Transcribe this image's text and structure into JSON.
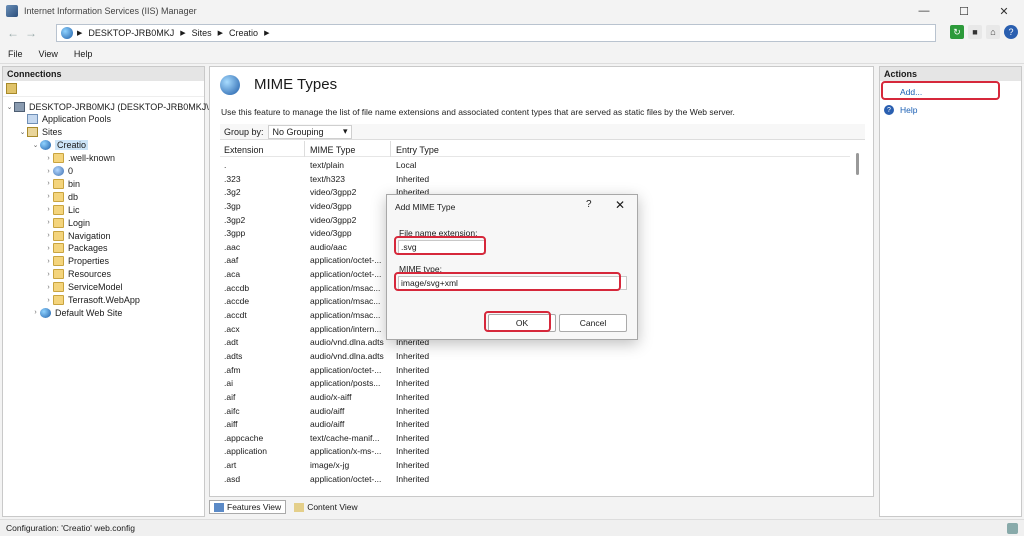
{
  "window": {
    "title": "Internet Information Services (IIS) Manager",
    "controls": [
      "—",
      "☐",
      "✕"
    ]
  },
  "address": {
    "breadcrumb": [
      "DESKTOP-JRB0MKJ",
      "Sites",
      "Creatio"
    ]
  },
  "menu": [
    "File",
    "View",
    "Help"
  ],
  "connections": {
    "header": "Connections",
    "tree": [
      {
        "label": "DESKTOP-JRB0MKJ (DESKTOP-JRB0MKJ\\Safa",
        "icon": "server-icon",
        "level": 0,
        "expander": "expanded"
      },
      {
        "label": "Application Pools",
        "icon": "app-pool-icon",
        "level": 1,
        "expander": "none"
      },
      {
        "label": "Sites",
        "icon": "sites-icon",
        "level": 1,
        "expander": "expanded"
      },
      {
        "label": "Creatio",
        "icon": "globe-icon",
        "level": 2,
        "expander": "expanded",
        "selected": true
      },
      {
        "label": ".well-known",
        "icon": "folder-icon",
        "level": 3,
        "expander": "collapsed"
      },
      {
        "label": "0",
        "icon": "app-icon",
        "level": 3,
        "expander": "collapsed"
      },
      {
        "label": "bin",
        "icon": "folder-icon",
        "level": 3,
        "expander": "collapsed"
      },
      {
        "label": "db",
        "icon": "folder-icon",
        "level": 3,
        "expander": "collapsed"
      },
      {
        "label": "Lic",
        "icon": "folder-icon",
        "level": 3,
        "expander": "collapsed"
      },
      {
        "label": "Login",
        "icon": "folder-icon",
        "level": 3,
        "expander": "collapsed"
      },
      {
        "label": "Navigation",
        "icon": "folder-icon",
        "level": 3,
        "expander": "collapsed"
      },
      {
        "label": "Packages",
        "icon": "folder-icon",
        "level": 3,
        "expander": "collapsed"
      },
      {
        "label": "Properties",
        "icon": "folder-icon",
        "level": 3,
        "expander": "collapsed"
      },
      {
        "label": "Resources",
        "icon": "folder-icon",
        "level": 3,
        "expander": "collapsed"
      },
      {
        "label": "ServiceModel",
        "icon": "folder-icon",
        "level": 3,
        "expander": "collapsed"
      },
      {
        "label": "Terrasoft.WebApp",
        "icon": "folder-icon",
        "level": 3,
        "expander": "collapsed"
      },
      {
        "label": "Default Web Site",
        "icon": "globe-icon",
        "level": 2,
        "expander": "collapsed"
      }
    ]
  },
  "content": {
    "title": "MIME Types",
    "description": "Use this feature to manage the list of file name extensions and associated content types that are served as static files by the Web server.",
    "group_by_label": "Group by:",
    "group_by_value": "No Grouping",
    "columns": [
      "Extension",
      "MIME Type",
      "Entry Type"
    ],
    "rows": [
      [
        ".",
        "text/plain",
        "Local"
      ],
      [
        ".323",
        "text/h323",
        "Inherited"
      ],
      [
        ".3g2",
        "video/3gpp2",
        "Inherited"
      ],
      [
        ".3gp",
        "video/3gpp",
        "Inherited"
      ],
      [
        ".3gp2",
        "video/3gpp2",
        "Inherited"
      ],
      [
        ".3gpp",
        "video/3gpp",
        "Inherited"
      ],
      [
        ".aac",
        "audio/aac",
        "Inherited"
      ],
      [
        ".aaf",
        "application/octet-...",
        "Inherited"
      ],
      [
        ".aca",
        "application/octet-...",
        "Inherited"
      ],
      [
        ".accdb",
        "application/msac...",
        "Inherited"
      ],
      [
        ".accde",
        "application/msac...",
        "Inherited"
      ],
      [
        ".accdt",
        "application/msac...",
        "Inherited"
      ],
      [
        ".acx",
        "application/intern...",
        "Inherited"
      ],
      [
        ".adt",
        "audio/vnd.dlna.adts",
        "Inherited"
      ],
      [
        ".adts",
        "audio/vnd.dlna.adts",
        "Inherited"
      ],
      [
        ".afm",
        "application/octet-...",
        "Inherited"
      ],
      [
        ".ai",
        "application/posts...",
        "Inherited"
      ],
      [
        ".aif",
        "audio/x-aiff",
        "Inherited"
      ],
      [
        ".aifc",
        "audio/aiff",
        "Inherited"
      ],
      [
        ".aiff",
        "audio/aiff",
        "Inherited"
      ],
      [
        ".appcache",
        "text/cache-manif...",
        "Inherited"
      ],
      [
        ".application",
        "application/x-ms-...",
        "Inherited"
      ],
      [
        ".art",
        "image/x-jg",
        "Inherited"
      ],
      [
        ".asd",
        "application/octet-...",
        "Inherited"
      ]
    ]
  },
  "view_tabs": [
    "Features View",
    "Content View"
  ],
  "actions": {
    "header": "Actions",
    "add": "Add...",
    "help": "Help"
  },
  "status": "Configuration: 'Creatio' web.config",
  "dialog": {
    "title": "Add MIME Type",
    "help_glyph": "?",
    "close_glyph": "✕",
    "ext_label": "File name extension:",
    "ext_value": ".svg",
    "mime_label": "MIME type:",
    "mime_value": "image/svg+xml",
    "ok": "OK",
    "cancel": "Cancel"
  },
  "colors": {
    "highlight": "#d6283b",
    "link": "#1a5fb4",
    "selection": "#cce4f7"
  }
}
